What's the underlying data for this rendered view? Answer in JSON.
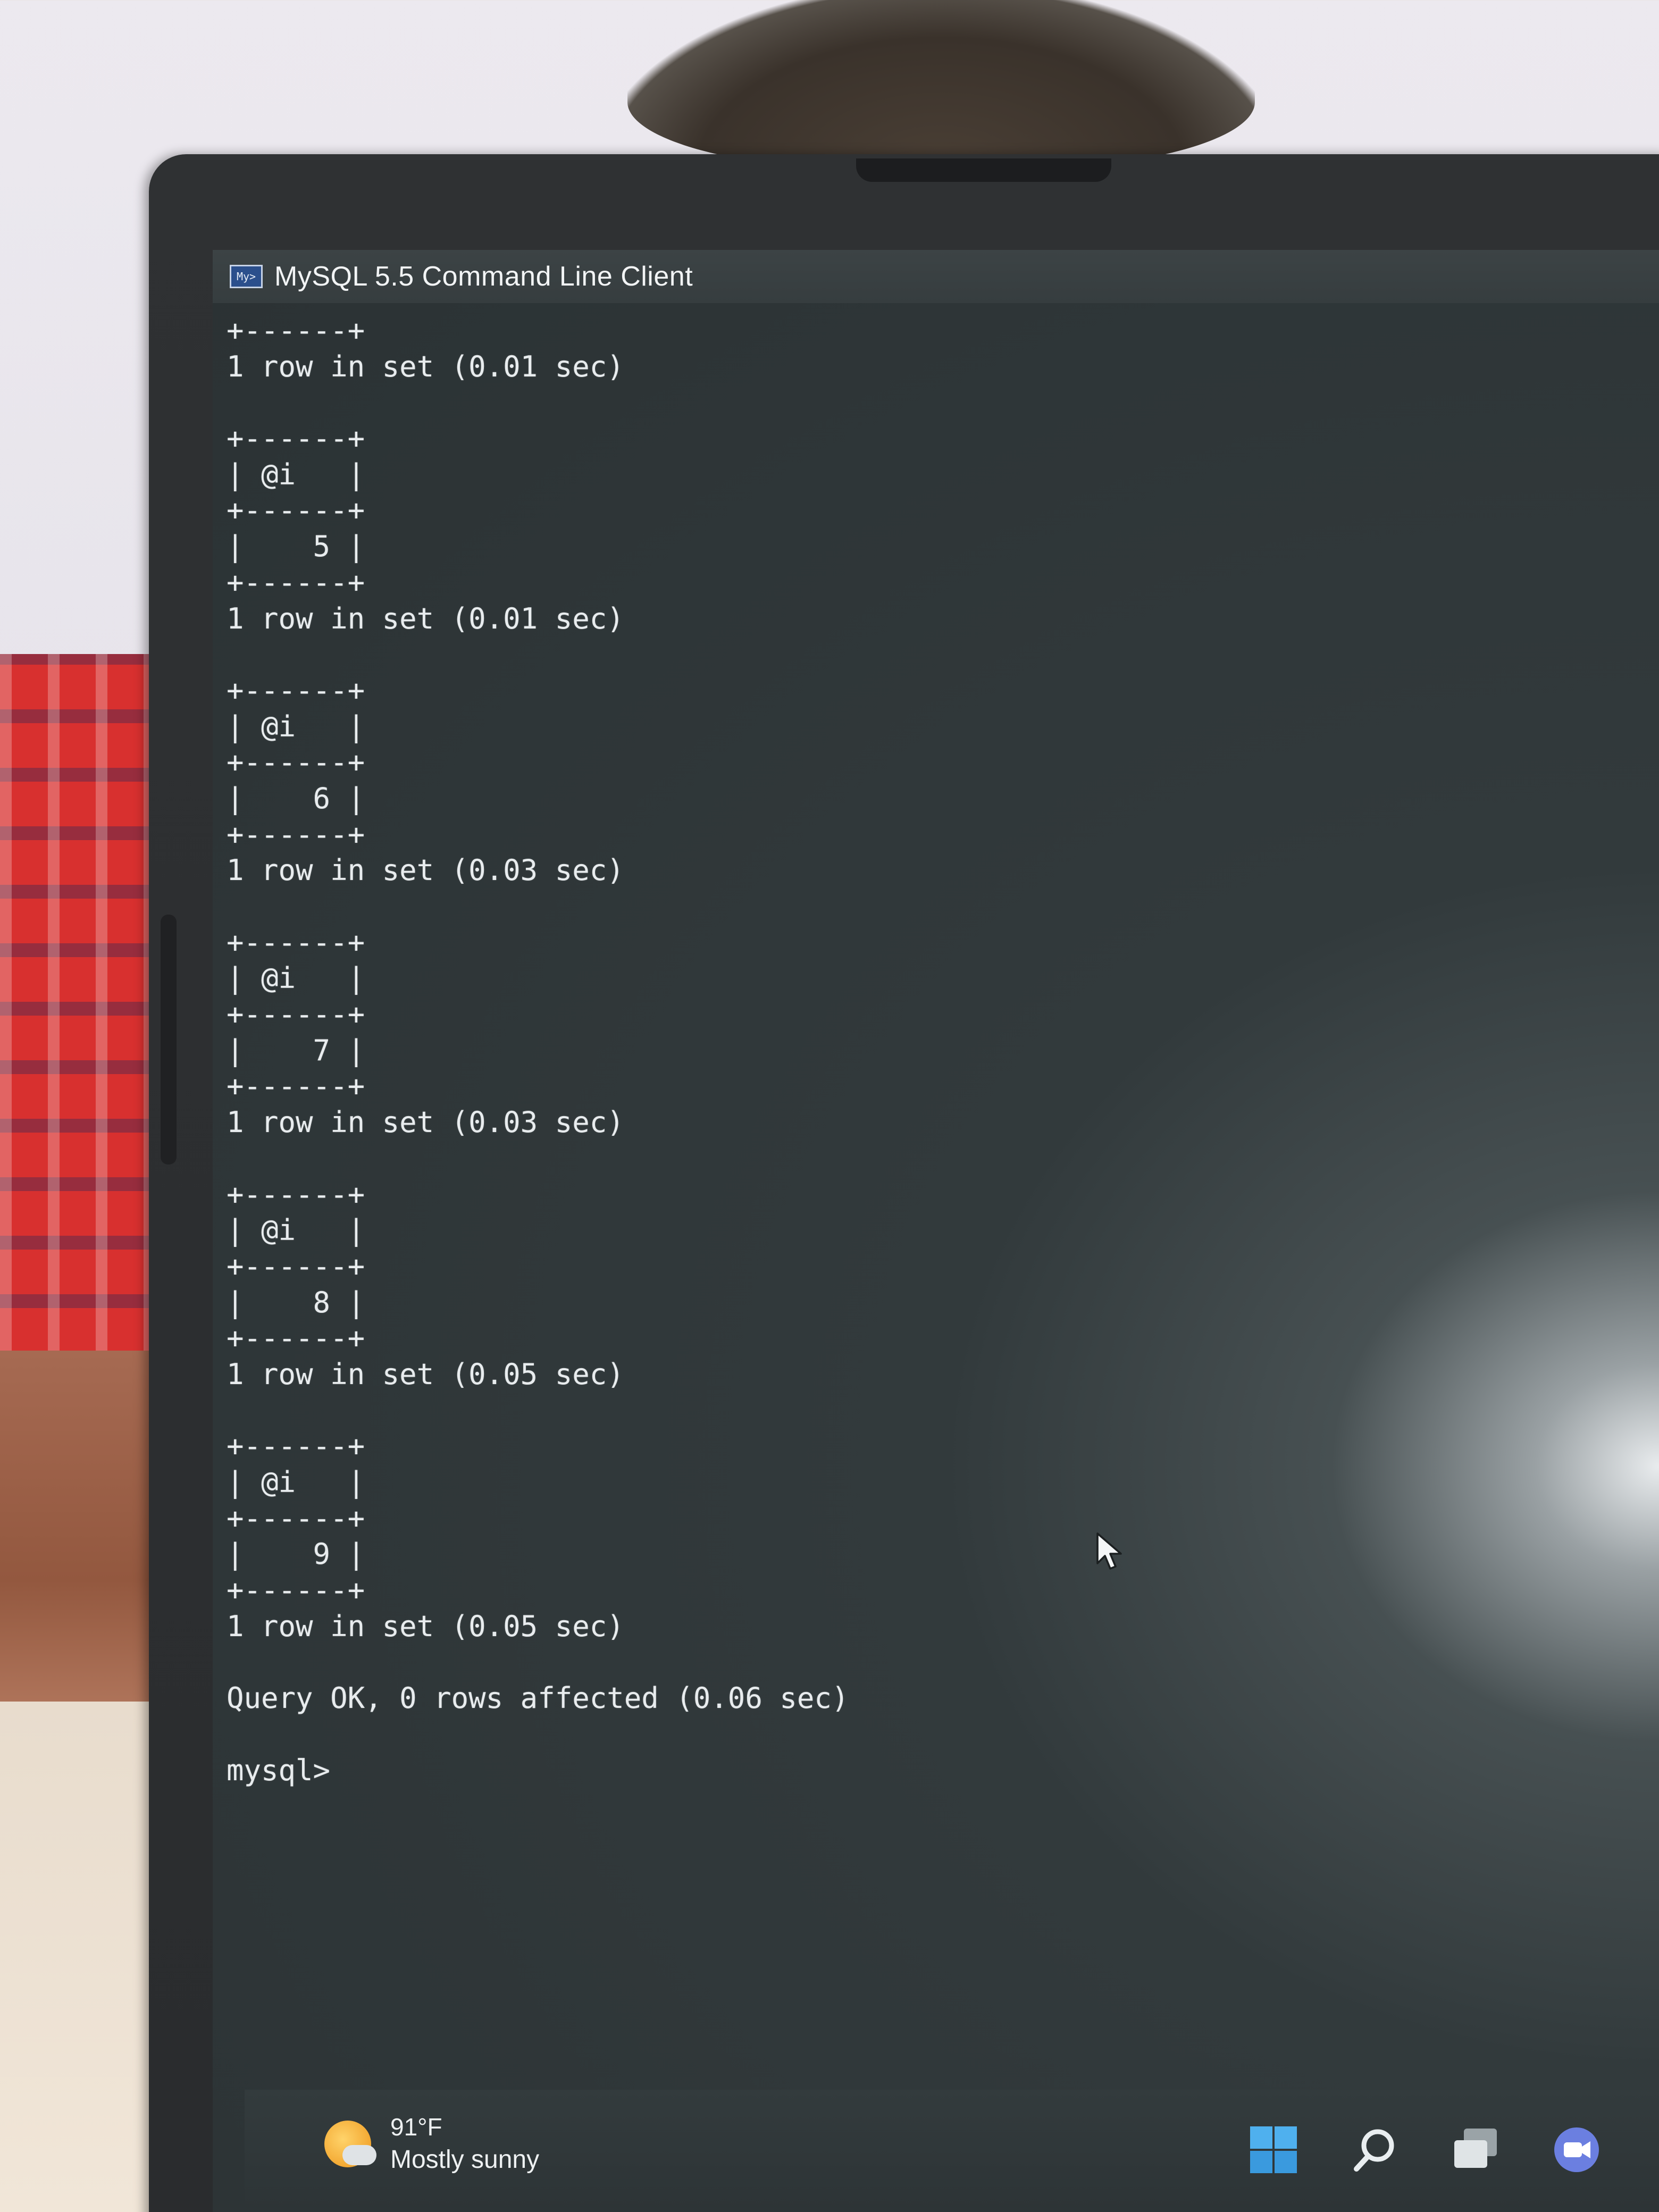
{
  "window": {
    "title": "MySQL 5.5 Command Line Client",
    "icon_label": "My>"
  },
  "console": {
    "lines": [
      "+------+",
      "1 row in set (0.01 sec)",
      "",
      "+------+",
      "| @i   |",
      "+------+",
      "|    5 |",
      "+------+",
      "1 row in set (0.01 sec)",
      "",
      "+------+",
      "| @i   |",
      "+------+",
      "|    6 |",
      "+------+",
      "1 row in set (0.03 sec)",
      "",
      "+------+",
      "| @i   |",
      "+------+",
      "|    7 |",
      "+------+",
      "1 row in set (0.03 sec)",
      "",
      "+------+",
      "| @i   |",
      "+------+",
      "|    8 |",
      "+------+",
      "1 row in set (0.05 sec)",
      "",
      "+------+",
      "| @i   |",
      "+------+",
      "|    9 |",
      "+------+",
      "1 row in set (0.05 sec)",
      "",
      "Query OK, 0 rows affected (0.06 sec)",
      "",
      "mysql>"
    ]
  },
  "taskbar": {
    "weather": {
      "temperature": "91°F",
      "condition": "Mostly sunny",
      "icon": "partly-sunny-icon"
    },
    "icons": [
      "windows-start-icon",
      "search-icon",
      "task-view-icon",
      "chat-icon"
    ]
  },
  "colors": {
    "console_bg": "#2b3234",
    "console_text": "#e8ecee",
    "windows_blue": "#3aa0e8"
  }
}
